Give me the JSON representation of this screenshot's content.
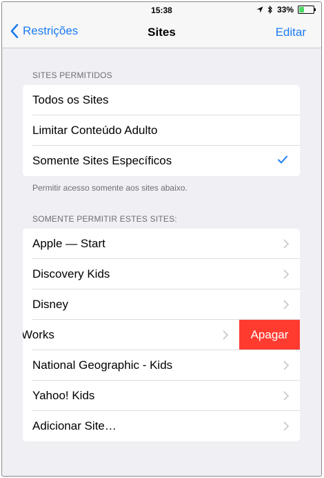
{
  "status_bar": {
    "time": "15:38",
    "battery_percent": "33%",
    "battery_level": 0.33,
    "icons": [
      "location-arrow-icon",
      "bluetooth-icon",
      "battery-icon"
    ]
  },
  "nav": {
    "back_label": "Restrições",
    "title": "Sites",
    "edit_label": "Editar"
  },
  "section_allowed": {
    "header": "SITES PERMITIDOS",
    "options": [
      {
        "label": "Todos os Sites",
        "selected": false
      },
      {
        "label": "Limitar Conteúdo Adulto",
        "selected": false
      },
      {
        "label": "Somente Sites Específicos",
        "selected": true
      }
    ],
    "footer": "Permitir acesso somente aos sites abaixo."
  },
  "section_sites": {
    "header": "SOMENTE PERMITIR ESTES SITES:",
    "items": [
      {
        "label": "Apple — Start"
      },
      {
        "label": "Discovery Kids"
      },
      {
        "label": "Disney"
      },
      {
        "label": "Works",
        "swiped": true,
        "delete_label": "Apagar"
      },
      {
        "label": "National Geographic - Kids"
      },
      {
        "label": "Yahoo! Kids"
      },
      {
        "label": "Adicionar Site…"
      }
    ]
  },
  "colors": {
    "accent": "#1a7cf2",
    "delete": "#ff3b30",
    "background": "#efeff4"
  }
}
